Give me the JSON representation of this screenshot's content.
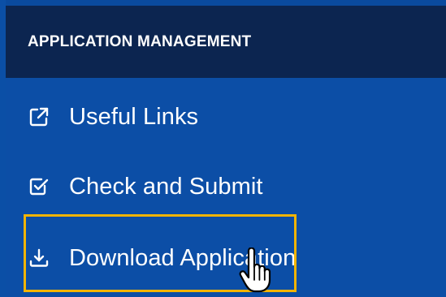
{
  "header": {
    "title": "APPLICATION MANAGEMENT"
  },
  "menu": {
    "items": [
      {
        "label": "Useful Links",
        "icon": "external-link-icon"
      },
      {
        "label": "Check and Submit",
        "icon": "checkbox-icon"
      },
      {
        "label": "Download Application",
        "icon": "download-icon"
      }
    ]
  },
  "colors": {
    "header_bg": "#0c2550",
    "menu_bg": "#0c4ea6",
    "highlight": "#f3b400",
    "text": "#ffffff"
  }
}
